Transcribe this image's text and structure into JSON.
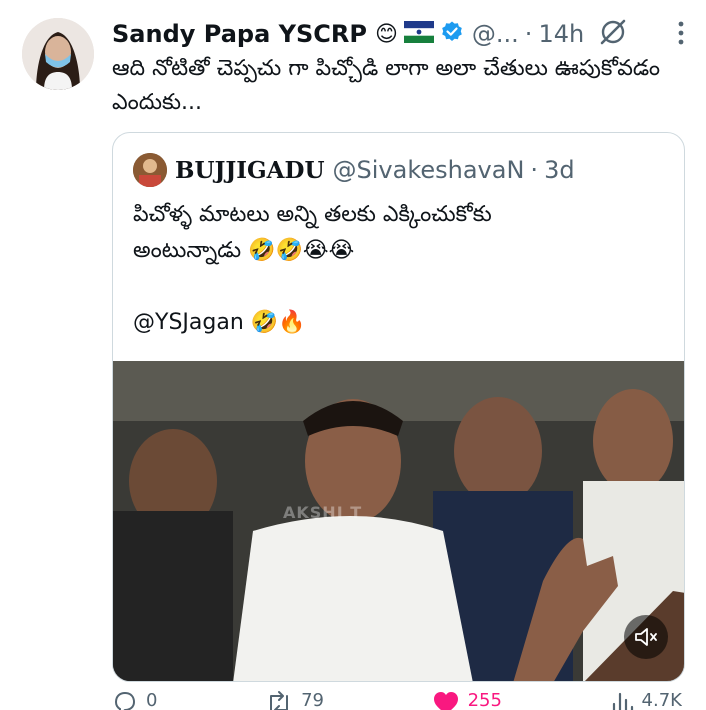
{
  "post": {
    "author_name": "Sandy Papa YSCRP",
    "author_emoji": "😊",
    "handle": "@...",
    "separator": "·",
    "time": "14h",
    "text": "ఆది నోటితో చెప్పచు గా పిచ్చోడి లాగా అలా చేతులు ఊపుకోవడం ఎందుకు..."
  },
  "quote": {
    "author_name": "BUJJIGADU",
    "handle": "@SivakeshavaN",
    "separator": "·",
    "time": "3d",
    "text": "పిచోళ్ళ మాటలు అన్ని తలకు ఎక్కించుకోకు\nఅంటున్నాడు 🤣🤣😭😭\n\n@YSJagan 🤣🔥",
    "video_watermark": "AKSHI T"
  },
  "actions": {
    "reply_count": "0",
    "repost_count": "79",
    "like_count": "255",
    "views_count": "4.7K"
  },
  "colors": {
    "verified": "#1d9bf0",
    "like": "#f91880",
    "secondary_text": "#536471"
  },
  "icons": [
    "avatar",
    "flag-icon",
    "verified-icon",
    "grok-icon",
    "more-icon",
    "mute-icon",
    "reply-icon",
    "repost-icon",
    "like-icon",
    "views-icon"
  ]
}
